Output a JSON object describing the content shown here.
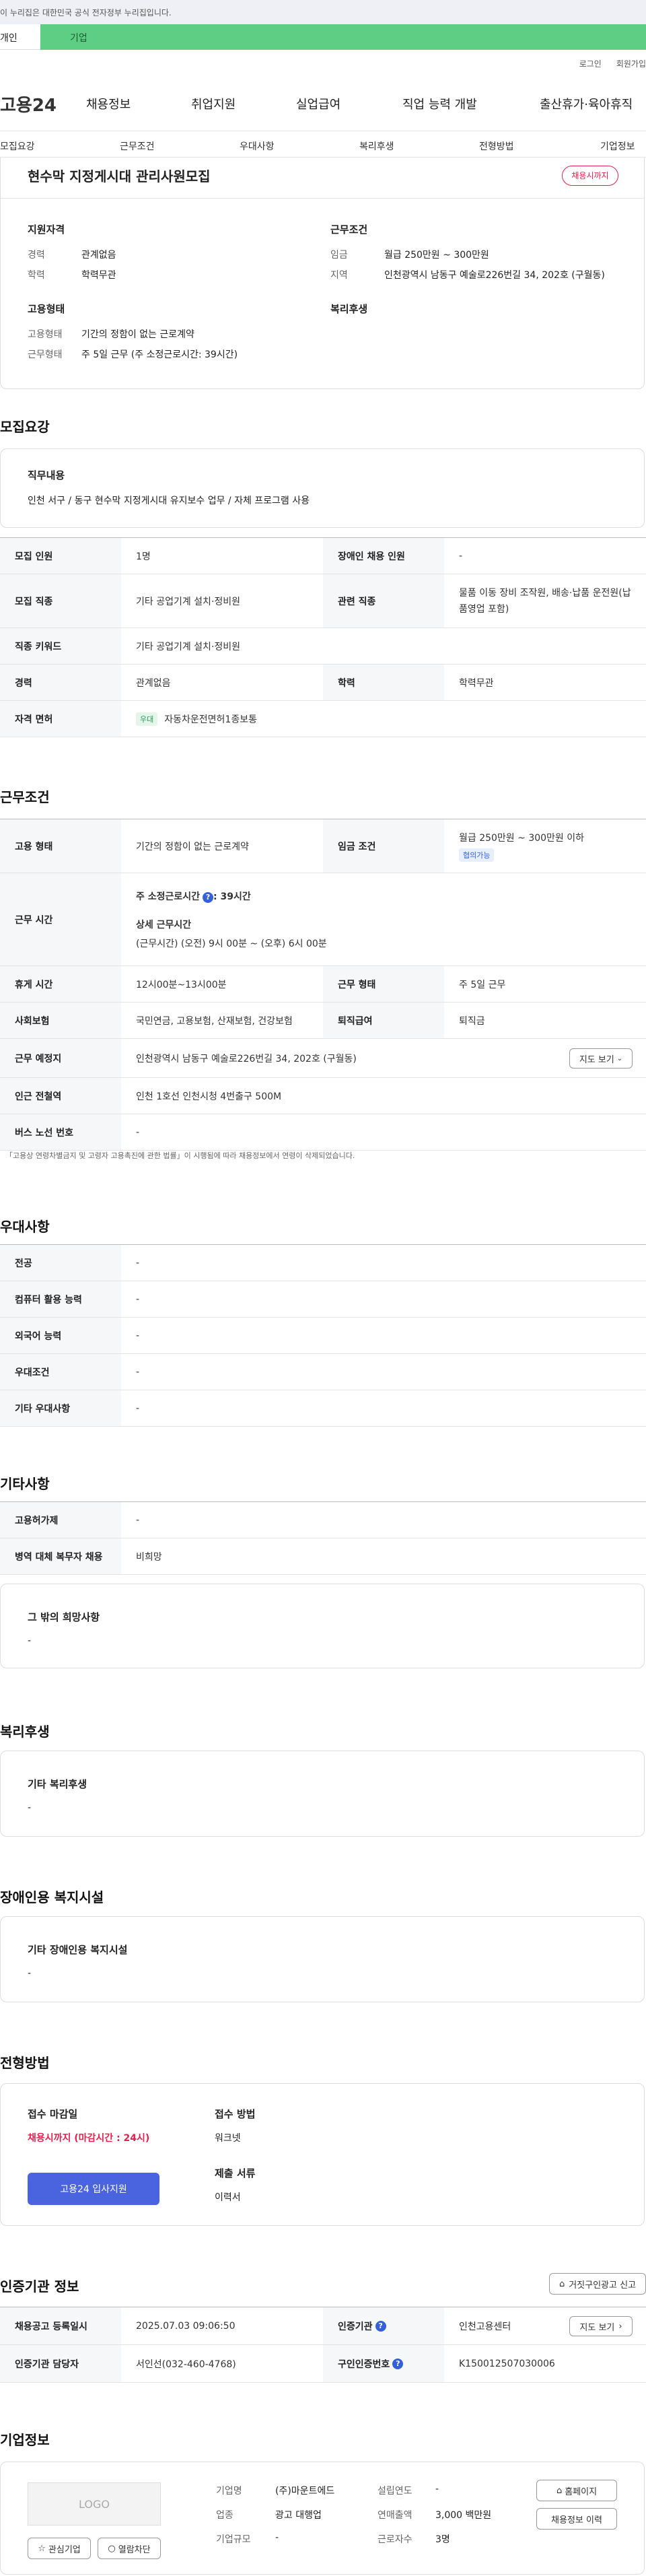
{
  "notice": {
    "text": "이 누리집은 대한민국 공식 전자정부 누리집입니다."
  },
  "top_tabs": [
    "개인",
    "기업"
  ],
  "util_links": [
    "로그인",
    "회원가입"
  ],
  "gnb": {
    "logo": "고용24",
    "items": [
      "채용정보",
      "취업지원",
      "실업급여",
      "직업 능력 개발",
      "출산휴가·육아휴직"
    ]
  },
  "subnav": [
    "모집요강",
    "근무조건",
    "우대사항",
    "복리후생",
    "전형방법",
    "기업정보"
  ],
  "summary": {
    "title": "현수막 지정게시대 관리사원모집",
    "badge": "채용시까지",
    "qual_heading": "지원자격",
    "qual": [
      {
        "label": "경력",
        "value": "관계없음"
      },
      {
        "label": "학력",
        "value": "학력무관"
      }
    ],
    "cond_heading": "근무조건",
    "cond": [
      {
        "label": "임금",
        "value": "월급 250만원 ~ 300만원"
      },
      {
        "label": "지역",
        "value": "인천광역시 남동구 예술로226번길 34, 202호 (구월동)"
      }
    ],
    "emp_heading": "고용형태",
    "emp": [
      {
        "label": "고용형태",
        "value": "기간의 정함이 없는 근로계약"
      },
      {
        "label": "근무형태",
        "value": "주 5일 근무 (주 소정근로시간: 39시간)"
      }
    ],
    "welfare_heading": "복리후생"
  },
  "recruit": {
    "title": "모집요강",
    "duty_heading": "직무내용",
    "duty": "인천 서구 / 동구 현수막 지정게시대 유지보수 업무 / 자체 프로그램 사용",
    "rows": [
      {
        "k1": "모집 인원",
        "v1": "1명",
        "k2": "장애인 채용 인원",
        "v2": "-"
      },
      {
        "k1": "모집 직종",
        "v1": "기타 공업기계 설치·정비원",
        "k2": "관련 직종",
        "v2": "물품 이동 장비 조작원, 배송·납품 운전원(납품영업 포함)"
      },
      {
        "k1": "직종 키워드",
        "v1": "기타 공업기계 설치·정비원"
      },
      {
        "k1": "경력",
        "v1": "관계없음",
        "k2": "학력",
        "v2": "학력무관"
      },
      {
        "k1": "자격 면허",
        "tag": "우대",
        "v1": "자동차운전면허1종보통"
      }
    ]
  },
  "work": {
    "title": "근무조건",
    "emp_type_k": "고용 형태",
    "emp_type_v": "기간의 정함이 없는 근로계약",
    "wage_k": "임금 조건",
    "wage_v": "월급 250만원 ~ 300만원 이하",
    "wage_tag": "협의가능",
    "hours_k": "근무 시간",
    "hours_main": "주 소정근로시간",
    "hours_main_v": ": 39시간",
    "hours_detail_h": "상세 근무시간",
    "hours_detail": "(근무시간) (오전) 9시 00분 ~ (오후) 6시 00분",
    "rest_k": "휴게 시간",
    "rest_v": "12시00분~13시00분",
    "form_k": "근무 형태",
    "form_v": "주 5일 근무",
    "insure_k": "사회보험",
    "insure_v": "국민연금, 고용보험, 산재보험, 건강보험",
    "retire_k": "퇴직급여",
    "retire_v": "퇴직금",
    "place_k": "근무 예정지",
    "place_v": "인천광역시 남동구 예술로226번길 34, 202호 (구월동)",
    "map_btn": "지도 보기",
    "subway_k": "인근 전철역",
    "subway_v": "인천 1호선 인천시청 4번출구 500M",
    "bus_k": "버스 노선 번호",
    "bus_v": "-",
    "footnote": "「고용상 연령차별금지 및 고령자 고용촉진에 관한 법률」이 시행됨에 따라 채용정보에서 연령이 삭제되었습니다."
  },
  "pref": {
    "title": "우대사항",
    "rows": [
      {
        "k": "전공",
        "v": "-"
      },
      {
        "k": "컴퓨터 활용 능력",
        "v": "-"
      },
      {
        "k": "외국어 능력",
        "v": "-"
      },
      {
        "k": "우대조건",
        "v": "-"
      },
      {
        "k": "기타 우대사항",
        "v": "-"
      }
    ]
  },
  "etc": {
    "title": "기타사항",
    "rows": [
      {
        "k": "고용허가제",
        "v": "-"
      },
      {
        "k": "병역 대체 복무자 채용",
        "v": "비희망"
      }
    ],
    "other_heading": "그 밖의 희망사항",
    "other_v": "-"
  },
  "welfare": {
    "title": "복리후생",
    "heading": "기타 복리후생",
    "v": "-"
  },
  "disabled": {
    "title": "장애인용 복지시설",
    "heading": "기타 장애인용 복지시설",
    "v": "-"
  },
  "process": {
    "title": "전형방법",
    "deadline_h": "접수 마감일",
    "deadline_v": "채용시까지 (마감시간 : 24시)",
    "apply_btn": "고용24 입사지원",
    "method_h": "접수 방법",
    "method_v": "워크넷",
    "docs_h": "제출 서류",
    "docs_v": "이력서"
  },
  "cert": {
    "title": "인증기관 정보",
    "report_btn": "거짓구인광고 신고",
    "reg_k": "채용공고 등록일시",
    "reg_v": "2025.07.03 09:06:50",
    "org_k": "인증기관",
    "org_v": "인천고용센터",
    "map_btn": "지도 보기",
    "staff_k": "인증기관 담당자",
    "staff_v": "서인선(032-460-4768)",
    "no_k": "구인인증번호",
    "no_v": "K150012507030006"
  },
  "company": {
    "title": "기업정보",
    "logo": "LOGO",
    "fav_btn": "관심기업",
    "block_btn": "열람차단",
    "fields": [
      {
        "k": "기업명",
        "v": "(주)마운트에드"
      },
      {
        "k": "업종",
        "v": "광고 대행업"
      },
      {
        "k": "기업규모",
        "v": "-"
      }
    ],
    "fields2": [
      {
        "k": "설립연도",
        "v": "-"
      },
      {
        "k": "연매출액",
        "v": "3,000 백만원"
      },
      {
        "k": "근로자수",
        "v": "3명"
      }
    ],
    "home_btn": "홈페이지",
    "jobs_btn": "채용정보 이력"
  },
  "colors": {
    "green": "#5ece84",
    "blue": "#3561d8",
    "red": "#e0234e"
  }
}
